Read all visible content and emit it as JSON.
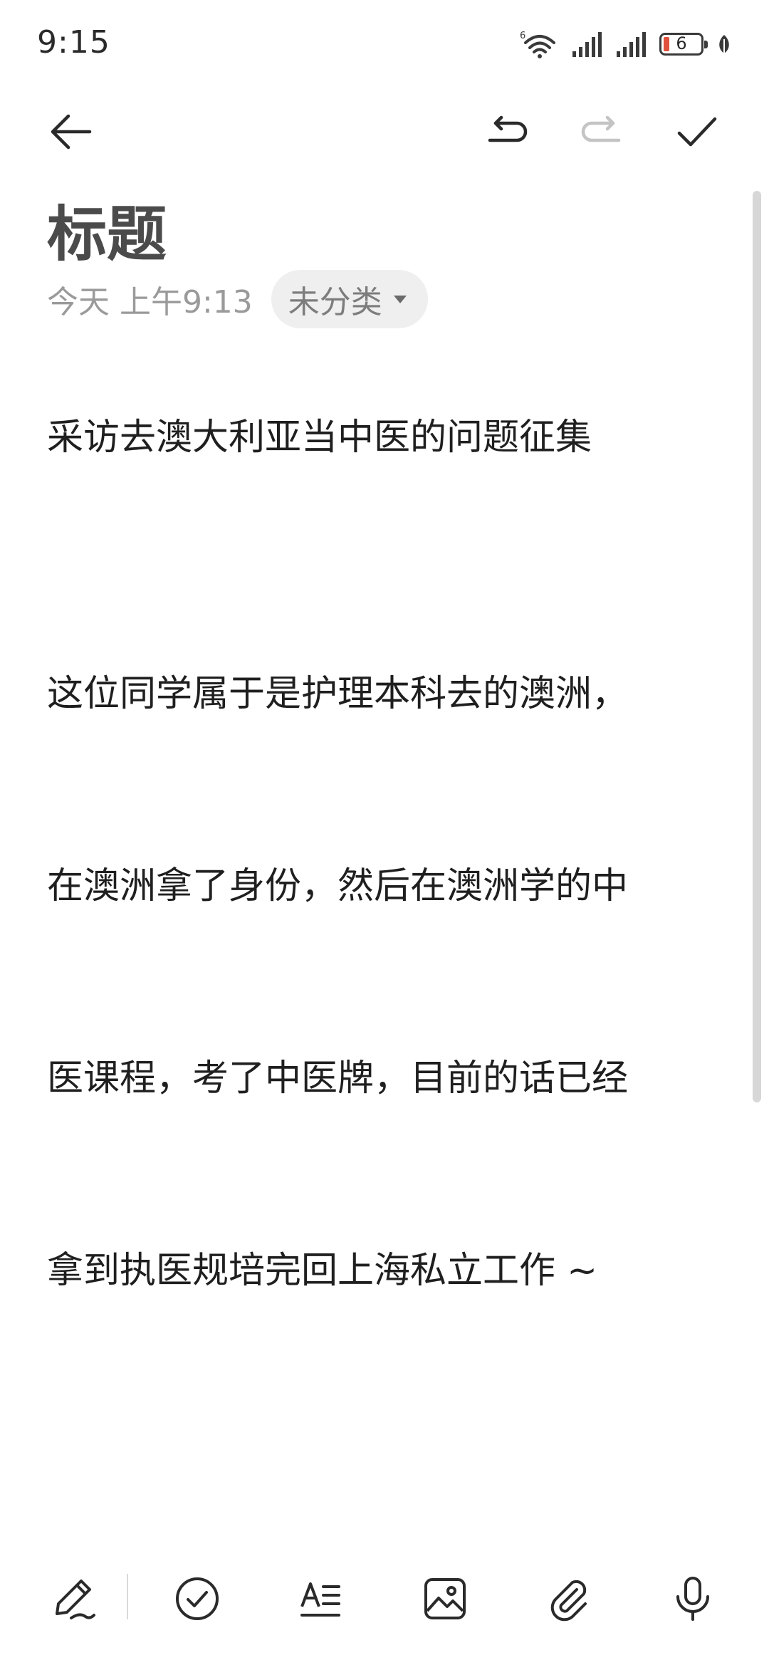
{
  "status_bar": {
    "time": "9:15",
    "battery_level": "6",
    "icons": [
      "wifi-6-icon",
      "signal-bars-icon",
      "signal-bars-icon",
      "battery-icon",
      "leaf-icon"
    ],
    "battery_color": "#e0513d"
  },
  "toolbar": {
    "icons": [
      "back-arrow-icon",
      "undo-icon",
      "redo-icon",
      "checkmark-icon"
    ]
  },
  "note": {
    "title": "标题",
    "date": "今天 上午9:13",
    "category": "未分类",
    "heading": "采访去澳大利亚当中医的问题征集",
    "paragraph_lines": [
      "这位同学属于是护理本科去的澳洲，",
      "在澳洲拿了身份，然后在澳洲学的中",
      "医课程，考了中医牌，目前的话已经",
      "拿到执医规培完回上海私立工作 ~"
    ]
  },
  "bottom_bar": {
    "icons": [
      "handwriting-pen-icon",
      "checklist-icon",
      "text-format-icon",
      "image-icon",
      "attachment-icon",
      "microphone-icon"
    ]
  }
}
